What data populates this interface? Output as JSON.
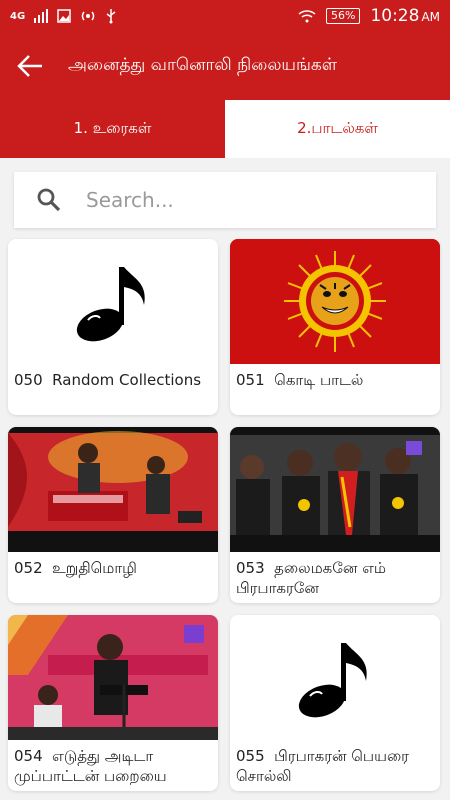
{
  "status_bar": {
    "network": "4G",
    "battery": "56%",
    "time": "10:28",
    "ampm": "AM"
  },
  "app_bar": {
    "title": "அனைத்து வானொலி நிலையங்கள்"
  },
  "tabs": [
    {
      "label": "1. உரைகள்",
      "active": false
    },
    {
      "label": "2.பாடல்கள்",
      "active": true
    }
  ],
  "search": {
    "placeholder": "Search..."
  },
  "items": [
    {
      "label": "050  Random Collections",
      "thumb": "music-note"
    },
    {
      "label": "051  கொடி பாடல்",
      "thumb": "tiger-flag"
    },
    {
      "label": "052  உறுதிமொழி",
      "thumb": "stage-photo"
    },
    {
      "label": "053  தலைமகனே எம் பிரபாகரனே",
      "thumb": "crowd-photo"
    },
    {
      "label": "054  எடுத்து அடிடா முப்பாட்டன் பறையை",
      "thumb": "singer-photo"
    },
    {
      "label": "055  பிரபாகரன் பெயரை சொல்லி",
      "thumb": "music-note"
    }
  ],
  "colors": {
    "primary": "#c91c1c",
    "background": "#f2f2f2"
  }
}
